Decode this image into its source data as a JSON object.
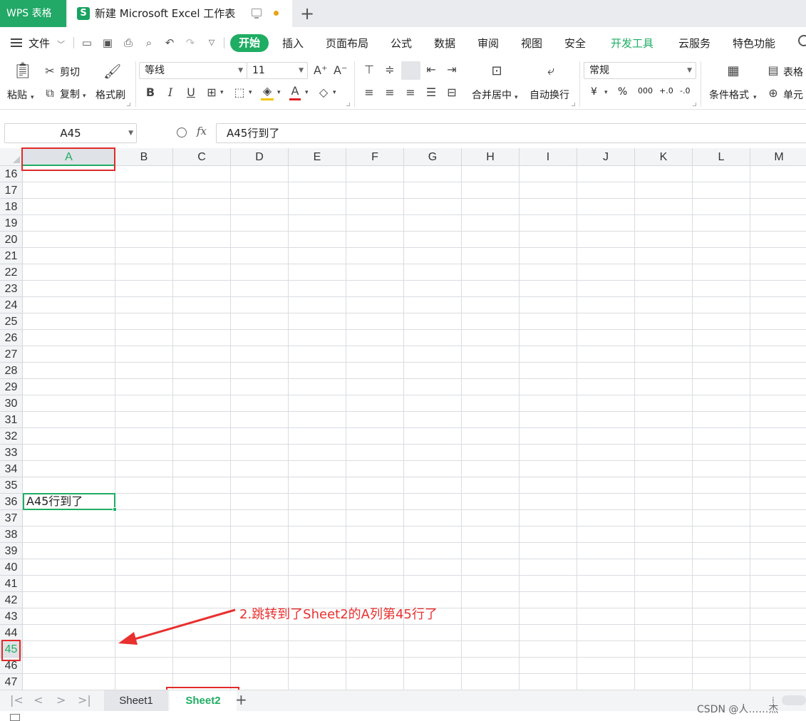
{
  "title_bar": {
    "app_tab": "WPS 表格",
    "doc_icon": "S",
    "doc_title": "新建 Microsoft Excel 工作表",
    "new_tab_icon": "+"
  },
  "menu": {
    "file": "文件",
    "items": [
      "开始",
      "插入",
      "页面布局",
      "公式",
      "数据",
      "审阅",
      "视图",
      "安全",
      "开发工具",
      "云服务",
      "特色功能"
    ]
  },
  "ribbon": {
    "paste": "粘贴",
    "cut": "剪切",
    "copy": "复制",
    "format_painter": "格式刷",
    "font_name": "等线",
    "font_size": "11",
    "merge_center": "合并居中",
    "wrap_text": "自动换行",
    "number_format": "常规",
    "currency": "¥",
    "percent": "%",
    "thousands": "000",
    "inc_decimal": "+.0",
    "dec_decimal": "-.0",
    "conditional_format": "条件格式",
    "table_style": "表格",
    "cell_style": "单元"
  },
  "formula_bar": {
    "name_box": "A45",
    "fx": "fx",
    "formula": "A45行到了"
  },
  "grid": {
    "columns": [
      "A",
      "B",
      "C",
      "D",
      "E",
      "F",
      "G",
      "H",
      "I",
      "J",
      "K",
      "L",
      "M"
    ],
    "active_column": "A",
    "rows": [
      "16",
      "17",
      "18",
      "19",
      "20",
      "21",
      "22",
      "23",
      "24",
      "25",
      "26",
      "27",
      "28",
      "29",
      "30",
      "31",
      "32",
      "33",
      "34",
      "35",
      "36",
      "37",
      "38",
      "39",
      "40",
      "41",
      "42",
      "43",
      "44",
      "45",
      "46",
      "47"
    ],
    "active_row": "45",
    "active_cell_value": "A45行到了"
  },
  "sheets": {
    "tabs": [
      "Sheet1",
      "Sheet2"
    ],
    "active": "Sheet2"
  },
  "annotation": {
    "text": "2.跳转到了Sheet2的A列第45行了"
  },
  "watermark": "CSDN @人……杰",
  "colors": {
    "accent_green": "#1fad63",
    "annotation_red": "#e02b2b"
  }
}
